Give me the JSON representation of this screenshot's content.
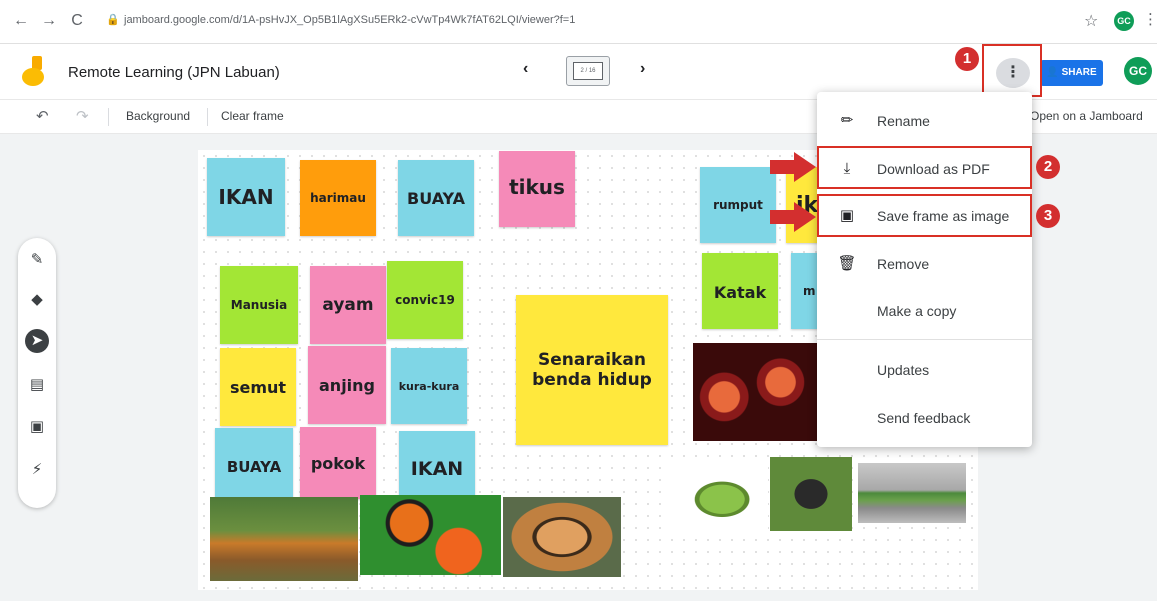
{
  "browser": {
    "url": "jamboard.google.com/d/1A-psHvJX_Op5B1lAgXSu5ERk2-cVwTp4Wk7fAT62LQI/viewer?f=1",
    "profile_initials": "GC"
  },
  "header": {
    "title": "Remote Learning (JPN Labuan)",
    "frame_indicator": "2 / 16",
    "share_label": "SHARE",
    "avatar_initials": "GC"
  },
  "toolbar": {
    "background_label": "Background",
    "clear_frame_label": "Clear frame",
    "open_label": "Open on a Jamboard"
  },
  "menu": {
    "items": [
      {
        "label": "Rename",
        "icon": "pencil-icon"
      },
      {
        "label": "Download as PDF",
        "icon": "download-icon"
      },
      {
        "label": "Save frame as image",
        "icon": "image-icon"
      },
      {
        "label": "Remove",
        "icon": "trash-icon"
      },
      {
        "label": "Make a copy",
        "icon": ""
      },
      {
        "label": "Updates",
        "icon": ""
      },
      {
        "label": "Send feedback",
        "icon": ""
      }
    ]
  },
  "annotations": {
    "badges": [
      "1",
      "2",
      "3"
    ],
    "color": "#d32f2f"
  },
  "notes": [
    {
      "text": "IKAN",
      "color": "cyan"
    },
    {
      "text": "harimau",
      "color": "orange"
    },
    {
      "text": "BUAYA",
      "color": "cyan"
    },
    {
      "text": "tikus",
      "color": "pink"
    },
    {
      "text": "rumput",
      "color": "cyan"
    },
    {
      "text": "ik",
      "color": "yellow"
    },
    {
      "text": "Manusia",
      "color": "green"
    },
    {
      "text": "ayam",
      "color": "pink"
    },
    {
      "text": "convic19",
      "color": "green"
    },
    {
      "text": "Katak",
      "color": "green"
    },
    {
      "text": "m",
      "color": "cyan"
    },
    {
      "text": "Senaraikan benda hidup",
      "color": "yellow"
    },
    {
      "text": "semut",
      "color": "yellow"
    },
    {
      "text": "anjing",
      "color": "pink"
    },
    {
      "text": "kura-kura",
      "color": "cyan"
    },
    {
      "text": "BUAYA",
      "color": "cyan"
    },
    {
      "text": "pokok",
      "color": "pink"
    },
    {
      "text": "IKAN",
      "color": "cyan"
    }
  ]
}
